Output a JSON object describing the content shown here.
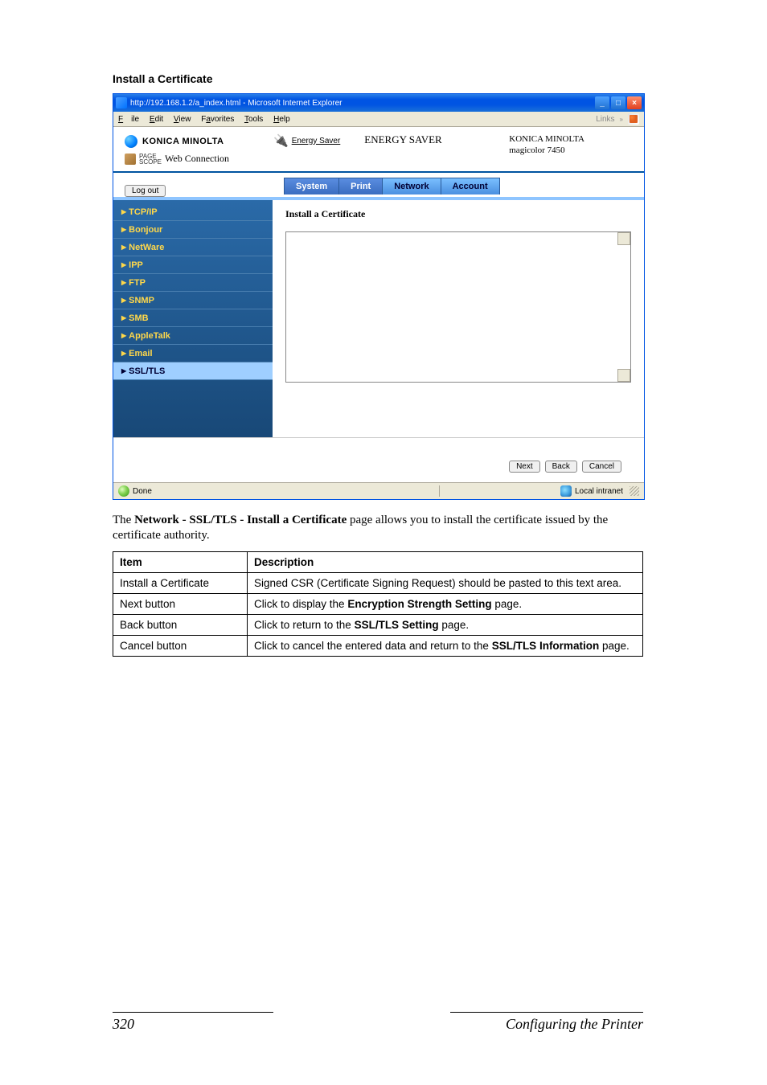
{
  "section_title": "Install a Certificate",
  "ie": {
    "title": "http://192.168.1.2/a_index.html - Microsoft Internet Explorer",
    "menubar": {
      "file": "File",
      "edit": "Edit",
      "view": "View",
      "favorites": "Favorites",
      "tools": "Tools",
      "help": "Help",
      "links": "Links"
    },
    "brand_logo": "KONICA MINOLTA",
    "pagescope_small": "PAGE\nSCOPE",
    "web_connection": "Web Connection",
    "energy_saver_btn": "Energy Saver",
    "energy_saver_title": "ENERGY SAVER",
    "device_brand": "KONICA MINOLTA",
    "device_model": "magicolor 7450",
    "logout": "Log out",
    "tabs": {
      "system": "System",
      "print": "Print",
      "network": "Network",
      "account": "Account"
    },
    "sidebar": [
      "TCP/IP",
      "Bonjour",
      "NetWare",
      "IPP",
      "FTP",
      "SNMP",
      "SMB",
      "AppleTalk",
      "Email",
      "SSL/TLS"
    ],
    "main_title": "Install a Certificate",
    "buttons": {
      "next": "Next",
      "back": "Back",
      "cancel": "Cancel"
    },
    "status_done": "Done",
    "status_intranet": "Local intranet"
  },
  "desc_prefix": "The ",
  "desc_bold": "Network - SSL/TLS - Install a Certificate",
  "desc_suffix": " page allows you to install the certificate issued by the certificate authority.",
  "table": {
    "h1": "Item",
    "h2": "Description",
    "rows": [
      {
        "item": "Install a Certificate",
        "desc_pre": "Signed CSR (Certificate Signing Request) should be pasted to this text area.",
        "bold": "",
        "desc_post": ""
      },
      {
        "item": "Next button",
        "desc_pre": "Click to display the ",
        "bold": "Encryption Strength Setting",
        "desc_post": " page."
      },
      {
        "item": "Back button",
        "desc_pre": "Click to return to the ",
        "bold": "SSL/TLS Setting",
        "desc_post": " page."
      },
      {
        "item": "Cancel button",
        "desc_pre": "Click to cancel the entered data and return to the ",
        "bold": "SSL/TLS Information",
        "desc_post": " page."
      }
    ]
  },
  "footer": {
    "page": "320",
    "section": "Configuring the Printer"
  }
}
